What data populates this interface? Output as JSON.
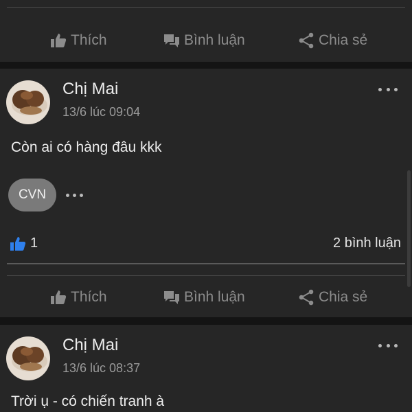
{
  "actions": {
    "like_label": "Thích",
    "comment_label": "Bình luận",
    "share_label": "Chia sẻ"
  },
  "posts": [
    {
      "author": "Chị Mai",
      "time": "13/6 lúc 09:04",
      "text": "Còn ai có hàng đâu kkk",
      "chip": "CVN",
      "likes": "1",
      "comments": "2 bình luận"
    },
    {
      "author": "Chị Mai",
      "time": "13/6 lúc 08:37",
      "text": "Trời ụ - có chiến tranh à"
    }
  ],
  "colors": {
    "background": "#141414",
    "card": "#262626",
    "action_text": "#8c8c8c",
    "like_blue": "#2f80ed"
  },
  "icons": {
    "like": "thumbs-up-icon",
    "comment": "speech-bubbles-icon",
    "share": "share-icon",
    "more": "ellipsis-icon"
  }
}
